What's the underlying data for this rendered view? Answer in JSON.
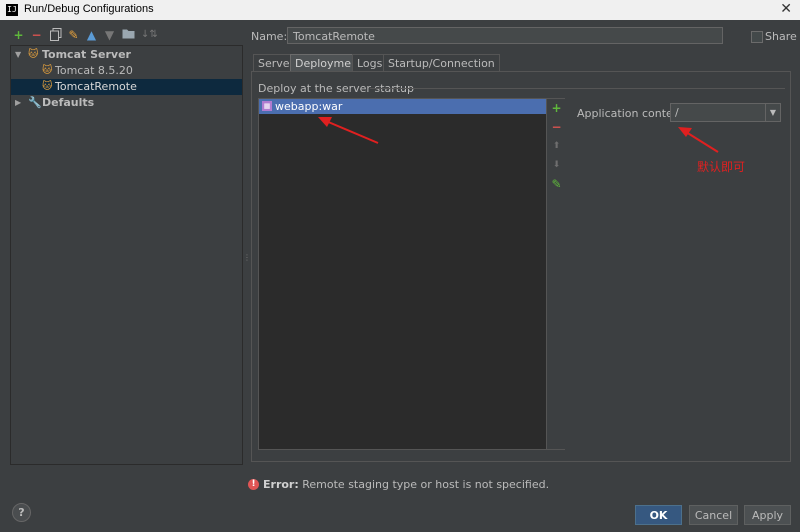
{
  "window": {
    "app_icon": "IJ",
    "title": "Run/Debug Configurations",
    "close_glyph": "✕"
  },
  "toolbar": {
    "icons": [
      "add-icon",
      "remove-icon",
      "copy-icon",
      "wrench-icon",
      "move-up-icon",
      "move-down-icon",
      "folder-icon",
      "sort-icon"
    ]
  },
  "tree": {
    "group": "Tomcat Server",
    "items": [
      "Tomcat 8.5.20",
      "TomcatRemote"
    ],
    "defaults": "Defaults"
  },
  "form": {
    "name_label": "Name:",
    "name_value": "TomcatRemote",
    "share_label": "Share",
    "share_checked": false
  },
  "tabs": [
    "Server",
    "Deployment",
    "Logs",
    "Startup/Connection"
  ],
  "active_tab": "Deployment",
  "deployment": {
    "section_label": "Deploy at the server startup",
    "artifacts": [
      "webapp:war"
    ],
    "context_label": "Application context:",
    "context_value": "/"
  },
  "annotation": {
    "text": "默认即可",
    "color": "#e02020"
  },
  "status": {
    "error_prefix": "Error:",
    "error_message": "Remote staging type or host is not specified."
  },
  "buttons": {
    "help": "?",
    "ok": "OK",
    "cancel": "Cancel",
    "apply": "Apply"
  },
  "colors": {
    "accent": "#4b6eaf",
    "primary_button": "#365880",
    "error": "#e05555",
    "tomcat": "#e8a33d"
  }
}
